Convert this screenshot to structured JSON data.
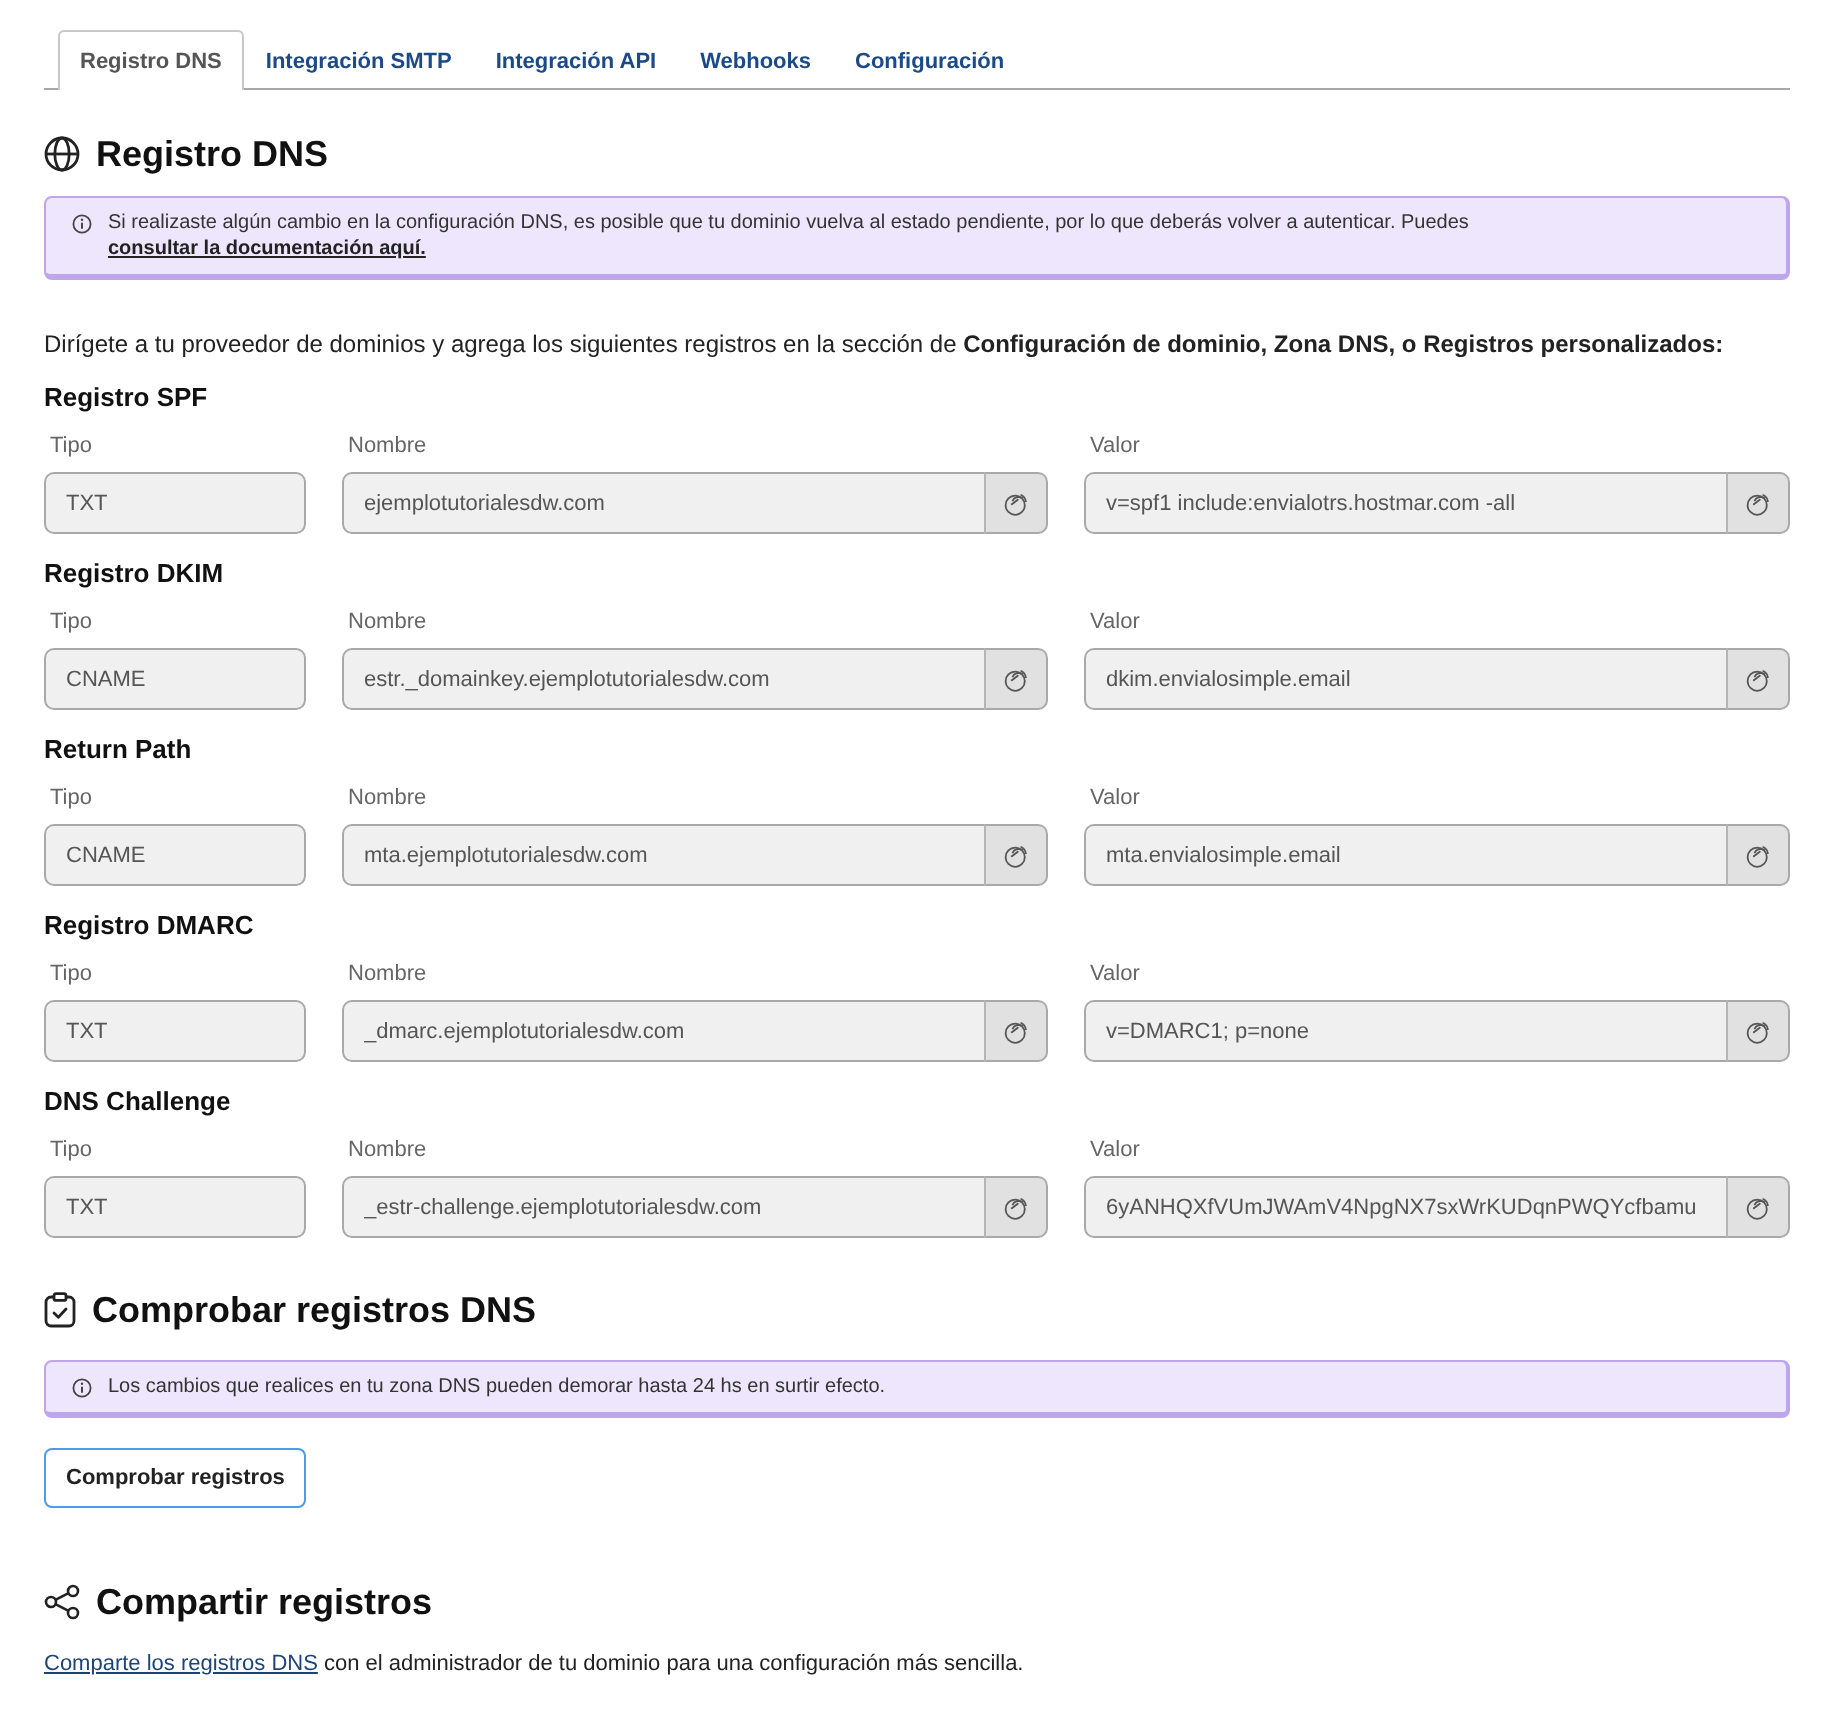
{
  "tabs": [
    {
      "label": "Registro DNS",
      "selected": true
    },
    {
      "label": "Integración SMTP",
      "selected": false
    },
    {
      "label": "Integración API",
      "selected": false
    },
    {
      "label": "Webhooks",
      "selected": false
    },
    {
      "label": "Configuración",
      "selected": false
    }
  ],
  "dns_section": {
    "title": "Registro DNS",
    "alert": {
      "text": "Si realizaste algún cambio en la configuración DNS, es posible que tu dominio vuelva al estado pendiente, por lo que deberás volver a autenticar. Puedes",
      "link": "consultar la documentación aquí."
    },
    "intro": "Dirígete a tu proveedor de dominios y agrega los siguientes registros en la sección de **Configuración de dominio, Zona DNS, o Registros personalizados:**",
    "records": [
      {
        "title": "Registro SPF",
        "fields": [
          {
            "label": "Tipo",
            "value": "TXT",
            "copyable": false
          },
          {
            "label": "Nombre",
            "value": "ejemplotutorialesdw.com",
            "copyable": true
          },
          {
            "label": "Valor",
            "value": "v=spf1 include:envialotrs.hostmar.com -all",
            "copyable": true
          }
        ]
      },
      {
        "title": "Registro DKIM",
        "fields": [
          {
            "label": "Tipo",
            "value": "CNAME",
            "copyable": false
          },
          {
            "label": "Nombre",
            "value": "estr._domainkey.ejemplotutorialesdw.com",
            "copyable": true
          },
          {
            "label": "Valor",
            "value": "dkim.envialosimple.email",
            "copyable": true
          }
        ]
      },
      {
        "title": "Return Path",
        "fields": [
          {
            "label": "Tipo",
            "value": "CNAME",
            "copyable": false
          },
          {
            "label": "Nombre",
            "value": "mta.ejemplotutorialesdw.com",
            "copyable": true
          },
          {
            "label": "Valor",
            "value": "mta.envialosimple.email",
            "copyable": true
          }
        ]
      },
      {
        "title": "Registro DMARC",
        "fields": [
          {
            "label": "Tipo",
            "value": "TXT",
            "copyable": false
          },
          {
            "label": "Nombre",
            "value": "_dmarc.ejemplotutorialesdw.com",
            "copyable": true
          },
          {
            "label": "Valor",
            "value": "v=DMARC1; p=none",
            "copyable": true
          }
        ]
      },
      {
        "title": "DNS Challenge",
        "fields": [
          {
            "label": "Tipo",
            "value": "TXT",
            "copyable": false
          },
          {
            "label": "Nombre",
            "value": "_estr-challenge.ejemplotutorialesdw.com",
            "copyable": true
          },
          {
            "label": "Valor",
            "value": "6yANHQXfVUmJWAmV4NpgNX7sxWrKUDqnPWQYcfbamu",
            "copyable": true
          }
        ]
      }
    ]
  },
  "check_section": {
    "title": "Comprobar registros DNS",
    "alert": {
      "text": "Los cambios que realices en tu zona DNS pueden demorar hasta 24 hs en surtir efecto."
    },
    "button": "Comprobar registros"
  },
  "share_section": {
    "title": "Compartir registros",
    "link": "Comparte los registros DNS",
    "text": "con el administrador de tu dominio para una configuración más sencilla."
  }
}
